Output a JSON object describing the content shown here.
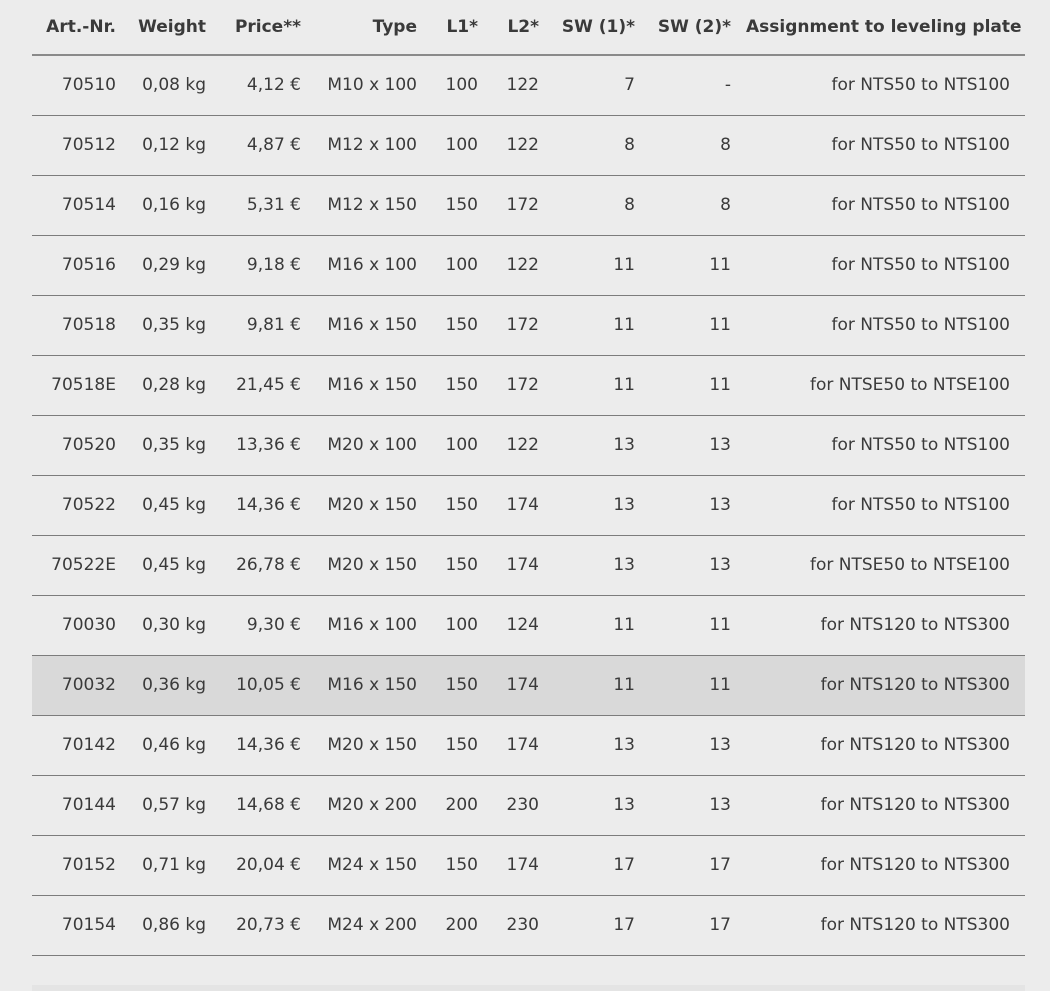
{
  "table": {
    "headers": [
      "Art.-Nr.",
      "Weight",
      "Price**",
      "Type",
      "L1*",
      "L2*",
      "SW (1)*",
      "SW (2)*",
      "Assignment to leveling plate"
    ],
    "highlight_row": 10,
    "rows": [
      [
        "70510",
        "0,08 kg",
        "4,12 €",
        "M10 x 100",
        "100",
        "122",
        "7",
        "-",
        "for NTS50 to NTS100"
      ],
      [
        "70512",
        "0,12 kg",
        "4,87 €",
        "M12 x 100",
        "100",
        "122",
        "8",
        "8",
        "for NTS50 to NTS100"
      ],
      [
        "70514",
        "0,16 kg",
        "5,31 €",
        "M12 x 150",
        "150",
        "172",
        "8",
        "8",
        "for NTS50 to NTS100"
      ],
      [
        "70516",
        "0,29 kg",
        "9,18 €",
        "M16 x 100",
        "100",
        "122",
        "11",
        "11",
        "for NTS50 to NTS100"
      ],
      [
        "70518",
        "0,35 kg",
        "9,81 €",
        "M16 x 150",
        "150",
        "172",
        "11",
        "11",
        "for NTS50 to NTS100"
      ],
      [
        "70518E",
        "0,28 kg",
        "21,45 €",
        "M16 x 150",
        "150",
        "172",
        "11",
        "11",
        "for NTSE50 to NTSE100"
      ],
      [
        "70520",
        "0,35 kg",
        "13,36 €",
        "M20 x 100",
        "100",
        "122",
        "13",
        "13",
        "for NTS50 to NTS100"
      ],
      [
        "70522",
        "0,45 kg",
        "14,36 €",
        "M20 x 150",
        "150",
        "174",
        "13",
        "13",
        "for NTS50 to NTS100"
      ],
      [
        "70522E",
        "0,45 kg",
        "26,78 €",
        "M20 x 150",
        "150",
        "174",
        "13",
        "13",
        "for NTSE50 to NTSE100"
      ],
      [
        "70030",
        "0,30 kg",
        "9,30 €",
        "M16 x 100",
        "100",
        "124",
        "11",
        "11",
        "for NTS120 to NTS300"
      ],
      [
        "70032",
        "0,36 kg",
        "10,05 €",
        "M16 x 150",
        "150",
        "174",
        "11",
        "11",
        "for NTS120 to NTS300"
      ],
      [
        "70142",
        "0,46 kg",
        "14,36 €",
        "M20 x 150",
        "150",
        "174",
        "13",
        "13",
        "for NTS120 to NTS300"
      ],
      [
        "70144",
        "0,57 kg",
        "14,68 €",
        "M20 x 200",
        "200",
        "230",
        "13",
        "13",
        "for NTS120 to NTS300"
      ],
      [
        "70152",
        "0,71 kg",
        "20,04 €",
        "M24 x 150",
        "150",
        "174",
        "17",
        "17",
        "for NTS120 to NTS300"
      ],
      [
        "70154",
        "0,86 kg",
        "20,73 €",
        "M24 x 200",
        "200",
        "230",
        "17",
        "17",
        "for NTS120 to NTS300"
      ]
    ]
  }
}
